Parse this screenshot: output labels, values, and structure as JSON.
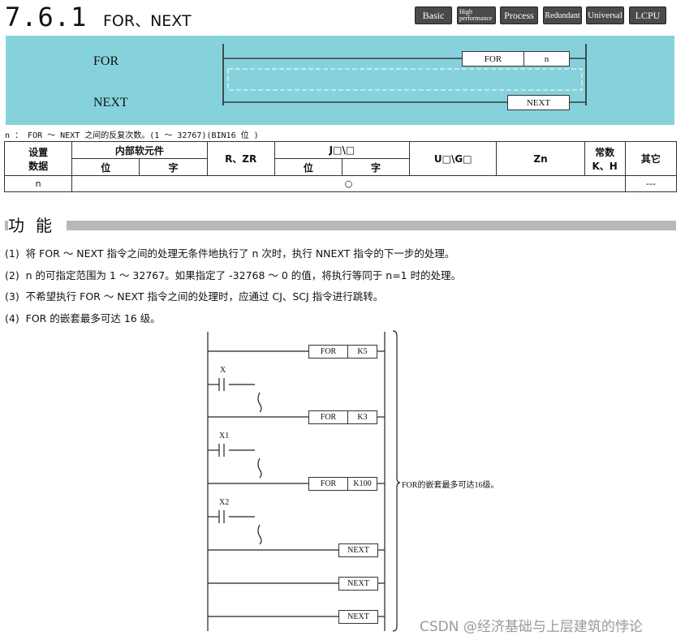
{
  "header": {
    "section_number": "7.6.1",
    "section_title": "FOR、NEXT",
    "badges": [
      "Basic",
      "High",
      "performance",
      "Process",
      "Redundant",
      "Universal",
      "LCPU"
    ]
  },
  "ladder": {
    "label_for": "FOR",
    "label_next": "NEXT",
    "instr_for": "FOR",
    "operand_n": "n",
    "instr_next": "NEXT"
  },
  "operand_note": "n ： FOR ～ NEXT 之间的反复次数。(1 ～ 32767)(BIN16 位 )",
  "device_table": {
    "h_setting_1": "设置",
    "h_setting_2": "数据",
    "h_internal": "内部软元件",
    "h_bit": "位",
    "h_word": "字",
    "h_r_zr": "R、ZR",
    "h_j": "J□\\□",
    "h_j_bit": "位",
    "h_j_word": "字",
    "h_u_g": "U□\\G□",
    "h_zn": "Zn",
    "h_const_1": "常数",
    "h_const_2": "K、H",
    "h_other": "其它",
    "row_name": "n",
    "row_mark": "○",
    "row_other": "---"
  },
  "function": {
    "title": "功能",
    "items": [
      "(1)  将 FOR ～ NEXT 指令之间的处理无条件地执行了 n 次时，执行 NNEXT 指令的下一步的处理。",
      "(2)  n 的可指定范围为 1 ～ 32767。如果指定了 -32768 ～ 0 的值，将执行等同于 n=1 时的处理。",
      "(3)  不希望执行 FOR ～ NEXT 指令之间的处理时，应通过 CJ、SCJ 指令进行跳转。",
      "(4)  FOR 的嵌套最多可达 16 级。"
    ]
  },
  "nesting": {
    "for1": "FOR",
    "k1": "K5",
    "x1": "X",
    "for2": "FOR",
    "k2": "K3",
    "x2": "X1",
    "for3": "FOR",
    "k3": "K100",
    "x3": "X2",
    "next1": "NEXT",
    "next2": "NEXT",
    "next3": "NEXT",
    "note": "FOR的嵌套最多可达16级。"
  },
  "watermark": "CSDN @经济基础与上层建筑的悖论"
}
